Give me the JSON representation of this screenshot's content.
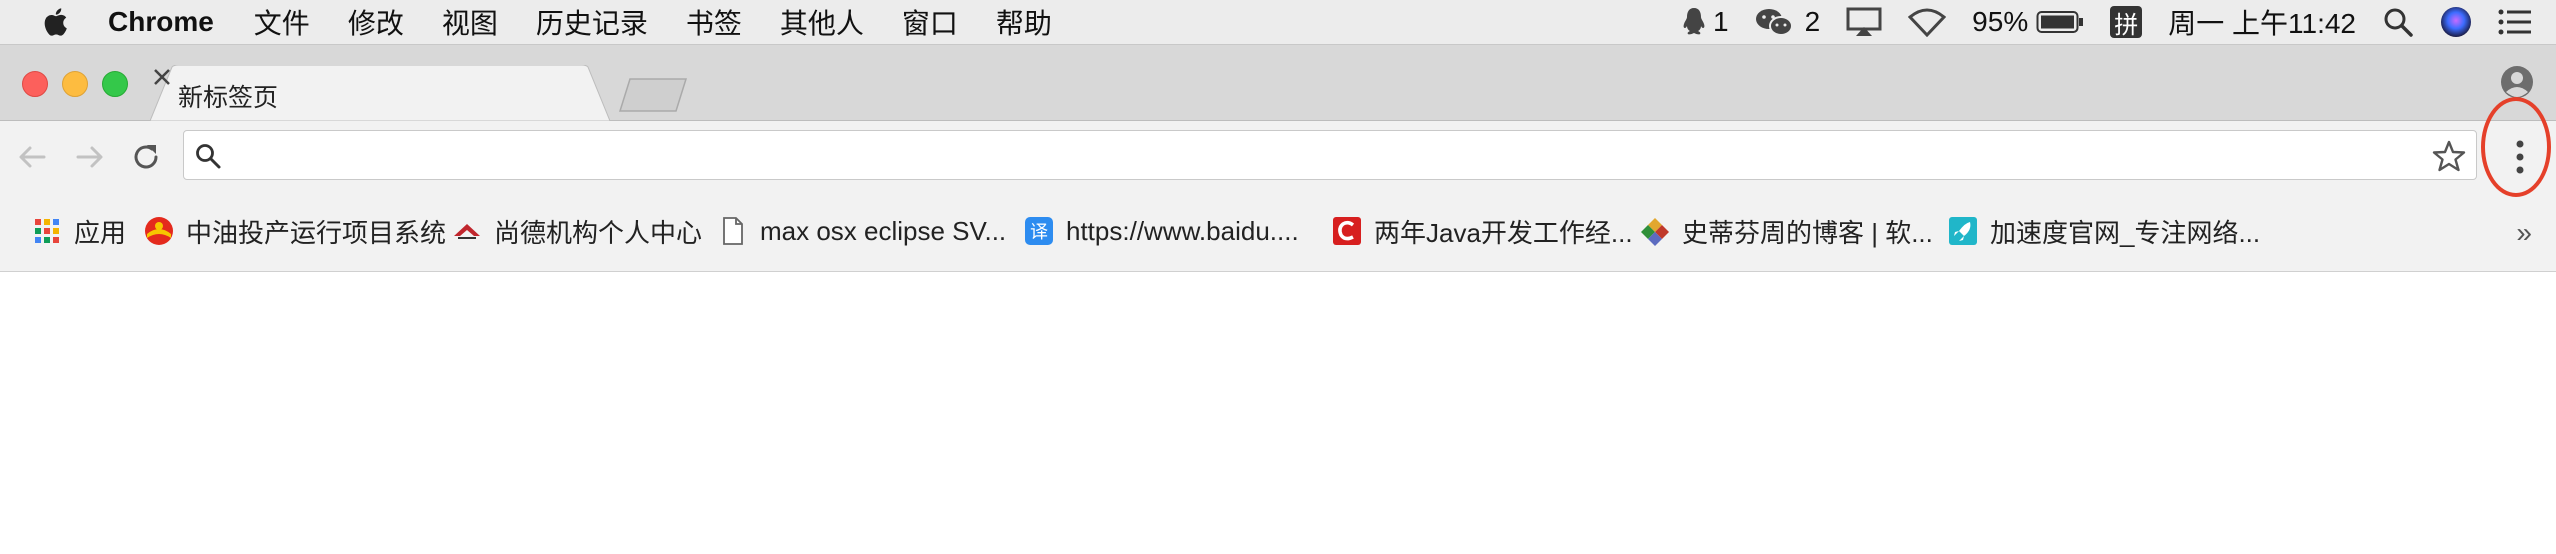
{
  "menubar": {
    "app_name": "Chrome",
    "items": [
      "文件",
      "修改",
      "视图",
      "历史记录",
      "书签",
      "其他人",
      "窗口",
      "帮助"
    ],
    "status": {
      "qq_count": "1",
      "wechat_count": "2",
      "battery": "95%",
      "input_method": "拼",
      "clock": "周一 上午11:42"
    }
  },
  "tab": {
    "title": "新标签页"
  },
  "omnibox": {
    "value": "",
    "placeholder": ""
  },
  "bookmarks": {
    "items": [
      {
        "label": "应用",
        "icon": "apps-grid-icon"
      },
      {
        "label": "中油投产运行项目系统",
        "icon": "cnpc-logo-icon"
      },
      {
        "label": "尚德机构个人中心",
        "icon": "sunlands-logo-icon"
      },
      {
        "label": "max osx eclipse SV...",
        "icon": "document-icon"
      },
      {
        "label": "https://www.baidu....",
        "icon": "translate-icon"
      },
      {
        "label": "两年Java开发工作经...",
        "icon": "csdn-logo-icon"
      },
      {
        "label": "史蒂芬周的博客 | 软...",
        "icon": "diamond-logo-icon"
      },
      {
        "label": "加速度官网_专注网络...",
        "icon": "rocket-icon"
      }
    ],
    "overflow": "»"
  },
  "colors": {
    "highlight_ring": "#e5402a",
    "close_red": "#fc605c",
    "minimize_yellow": "#fdbc40",
    "zoom_green": "#34c84a"
  }
}
